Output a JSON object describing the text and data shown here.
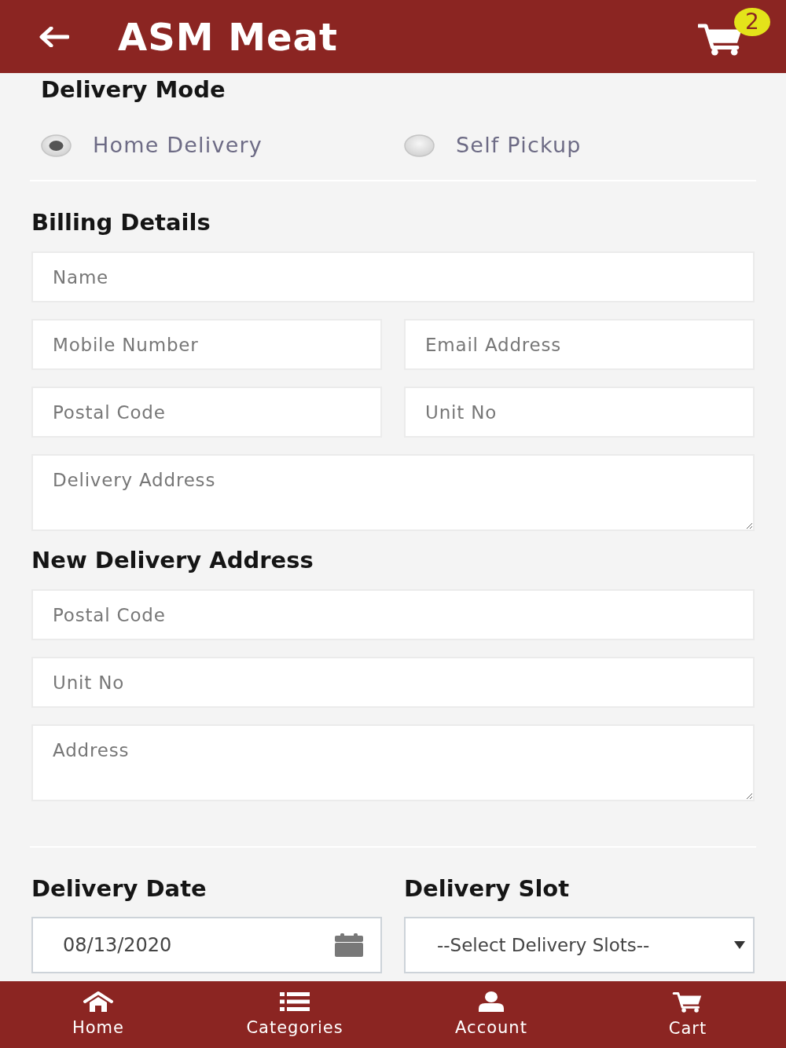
{
  "header": {
    "title": "ASM Meat",
    "cart_count": "2"
  },
  "delivery_mode": {
    "heading": "Delivery Mode",
    "options": [
      {
        "label": "Home Delivery",
        "selected": true
      },
      {
        "label": "Self Pickup",
        "selected": false
      }
    ]
  },
  "billing_details": {
    "heading": "Billing Details",
    "rows": [
      {
        "fields": [
          {
            "kind": "input",
            "placeholder": "Name"
          }
        ]
      },
      {
        "fields": [
          {
            "kind": "input",
            "placeholder": "Mobile Number"
          },
          {
            "kind": "input",
            "placeholder": "Email Address"
          }
        ]
      },
      {
        "fields": [
          {
            "kind": "input",
            "placeholder": "Postal Code"
          },
          {
            "kind": "input",
            "placeholder": "Unit No"
          }
        ]
      },
      {
        "fields": [
          {
            "kind": "textarea",
            "placeholder": "Delivery Address"
          }
        ]
      }
    ]
  },
  "new_delivery_address": {
    "heading": "New Delivery Address",
    "rows": [
      {
        "fields": [
          {
            "kind": "input",
            "placeholder": "Postal Code"
          }
        ]
      },
      {
        "fields": [
          {
            "kind": "input",
            "placeholder": "Unit No"
          }
        ]
      },
      {
        "fields": [
          {
            "kind": "textarea",
            "placeholder": "Address"
          }
        ]
      }
    ]
  },
  "delivery_date": {
    "label": "Delivery Date",
    "value": "08/13/2020"
  },
  "delivery_slot": {
    "label": "Delivery Slot",
    "value": "--Select Delivery Slots--"
  },
  "bottom_nav": [
    {
      "kind": "home",
      "label": "Home"
    },
    {
      "kind": "categories",
      "label": "Categories"
    },
    {
      "kind": "account",
      "label": "Account"
    },
    {
      "kind": "cart",
      "label": "Cart"
    }
  ]
}
